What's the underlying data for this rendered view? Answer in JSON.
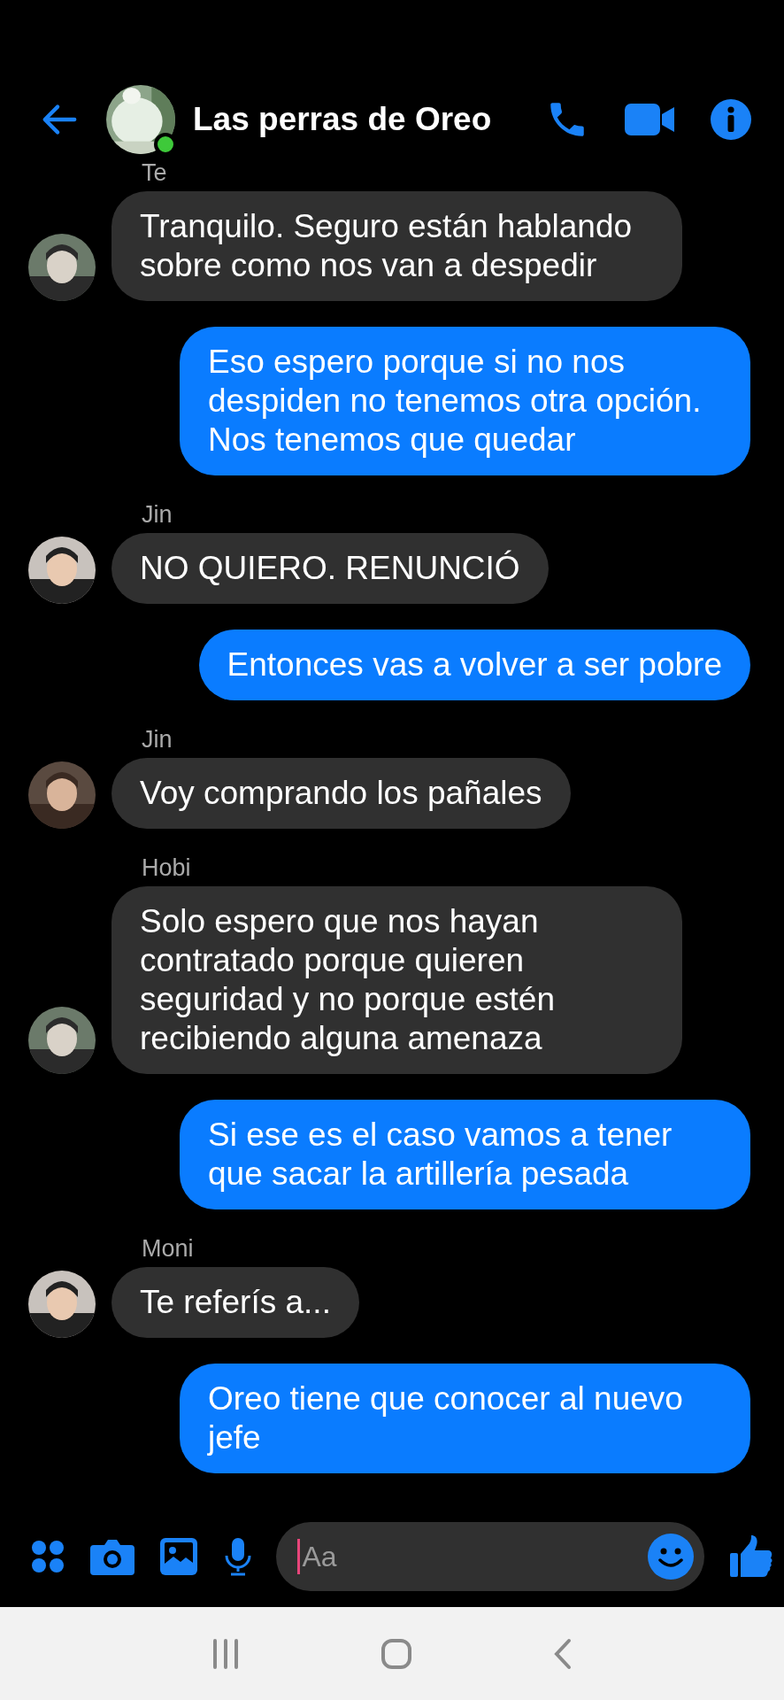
{
  "header": {
    "title": "Las perras de Oreo",
    "online": true
  },
  "messages": [
    {
      "kind": "received",
      "sender": "Te",
      "text": "Tranquilo. Seguro están hablando sobre como nos van a despedir",
      "avatar": true
    },
    {
      "kind": "sent",
      "text": "Eso espero porque si no nos despiden no tenemos otra opción. Nos tenemos que quedar"
    },
    {
      "kind": "received",
      "sender": "Jin",
      "text": "NO QUIERO. RENUNCIÓ",
      "avatar": true
    },
    {
      "kind": "sent",
      "text": "Entonces vas a volver a ser pobre"
    },
    {
      "kind": "received",
      "sender": "Jin",
      "text": "Voy comprando los pañales",
      "avatar": true
    },
    {
      "kind": "received",
      "sender": "Hobi",
      "text": "Solo espero que nos hayan contratado porque quieren seguridad y no porque estén recibiendo alguna amenaza",
      "avatar": true
    },
    {
      "kind": "sent",
      "text": "Si ese es el caso vamos a tener que sacar la artillería pesada"
    },
    {
      "kind": "received",
      "sender": "Moni",
      "text": "Te referís a...",
      "avatar": true
    },
    {
      "kind": "sent",
      "text": "Oreo tiene que conocer al nuevo jefe"
    }
  ],
  "composer": {
    "placeholder": "Aa"
  }
}
